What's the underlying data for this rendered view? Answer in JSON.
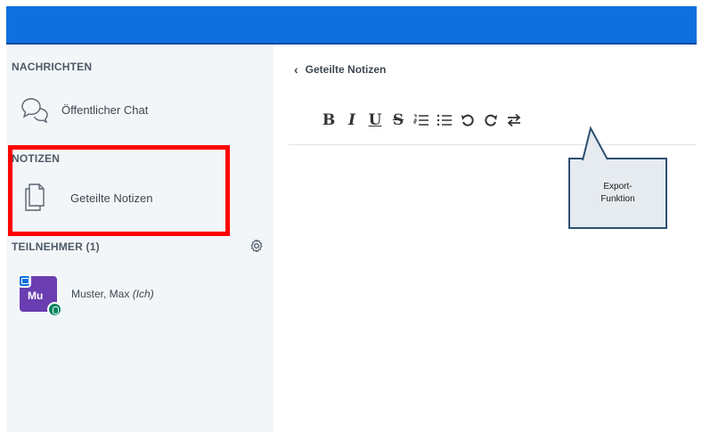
{
  "sidebar": {
    "messages": {
      "title": "NACHRICHTEN",
      "public_chat": "Öffentlicher Chat"
    },
    "notes": {
      "title": "NOTIZEN",
      "shared_notes": "Geteilte Notizen"
    },
    "participants": {
      "title": "TEILNEHMER (1)",
      "users": [
        {
          "initials": "Mu",
          "name": "Muster, Max",
          "you_label": "(Ich)"
        }
      ]
    }
  },
  "main": {
    "back_title": "Geteilte Notizen",
    "toolbar": {
      "bold": "B",
      "italic": "I",
      "underline": "U",
      "strike": "S"
    }
  },
  "annotation": {
    "line1": "Export-",
    "line2": "Funktion"
  },
  "colors": {
    "topbar": "#0e70df",
    "avatar": "#6a3db1",
    "highlight": "#ff0000",
    "mic": "#00845f"
  }
}
